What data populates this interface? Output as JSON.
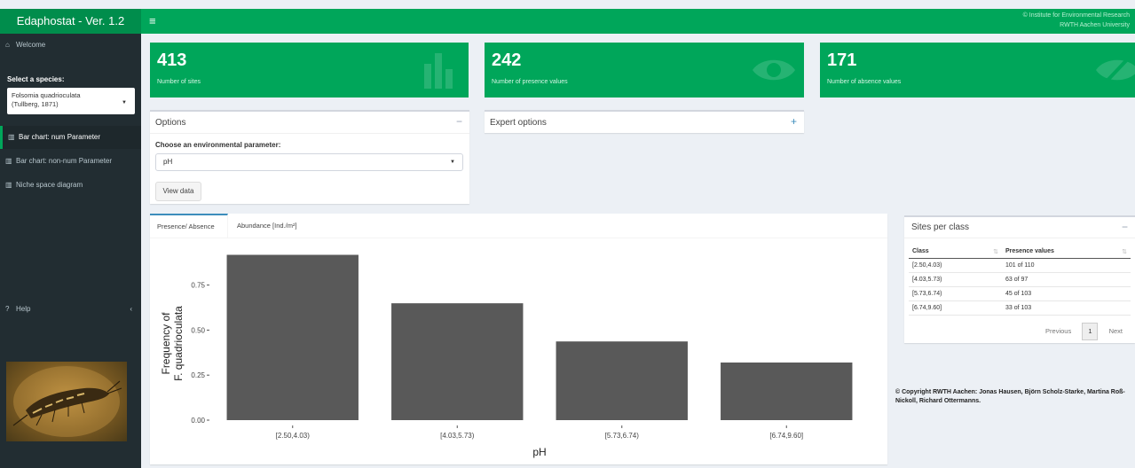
{
  "header": {
    "app_title": "Edaphostat - Ver. 1.2",
    "menu_icon": "hamburger-icon",
    "note_line1": "© Institute for Environmental Research",
    "note_line2": "RWTH Aachen University"
  },
  "sidebar": {
    "welcome": "Welcome",
    "select_label": "Select a species:",
    "species_line1": "Folsomia quadrioculata",
    "species_line2": "(Tullberg, 1871)",
    "menu": [
      {
        "label": "Bar chart: num Parameter",
        "icon": "bar-chart-icon"
      },
      {
        "label": "Bar chart: non-num Parameter",
        "icon": "bar-chart-icon"
      },
      {
        "label": "Niche space diagram",
        "icon": "bar-chart-icon"
      }
    ],
    "help": "Help"
  },
  "value_boxes": [
    {
      "number": "413",
      "label": "Number of sites",
      "icon": "bar-chart-icon"
    },
    {
      "number": "242",
      "label": "Number of presence values",
      "icon": "eye-icon"
    },
    {
      "number": "171",
      "label": "Number of absence values",
      "icon": "eye-slash-icon"
    }
  ],
  "options": {
    "title": "Options",
    "collapse_symbol": "−",
    "param_label": "Choose an environmental parameter:",
    "param_value": "pH",
    "view_button": "View data"
  },
  "expert": {
    "title": "Expert options",
    "expand_symbol": "+"
  },
  "tabs": {
    "presence": "Presence/ Absence",
    "abundance": "Abundance [Ind./m²]"
  },
  "chart_data": {
    "type": "bar",
    "categories": [
      "[2.50,4.03)",
      "[4.03,5.73)",
      "[5.73,6.74)",
      "[6.74,9.60]"
    ],
    "values": [
      0.918,
      0.649,
      0.437,
      0.32
    ],
    "xlabel": "pH",
    "ylabel_line1": "Frequency of",
    "ylabel_line2": "F. quadrioculata",
    "yticks": [
      "0.00",
      "0.25",
      "0.50",
      "0.75"
    ],
    "ylim": [
      0,
      0.95
    ],
    "bar_color": "#595959"
  },
  "sites_per_class": {
    "title": "Sites per class",
    "collapse_symbol": "−",
    "columns": [
      "Class",
      "Presence values"
    ],
    "rows": [
      [
        "[2.50,4.03)",
        "101 of 110"
      ],
      [
        "[4.03,5.73)",
        "63 of 97"
      ],
      [
        "[5.73,6.74)",
        "45 of 103"
      ],
      [
        "[6.74,9.60]",
        "33 of 103"
      ]
    ],
    "prev": "Previous",
    "page": "1",
    "next": "Next"
  },
  "copyright": "© Copyright RWTH Aachen: Jonas Hausen, Björn Scholz-Starke, Martina Roß-Nickoll, Richard Ottermanns.",
  "colors": {
    "accent": "#00a65a",
    "sidebar": "#222d32",
    "background": "#ecf0f5"
  }
}
